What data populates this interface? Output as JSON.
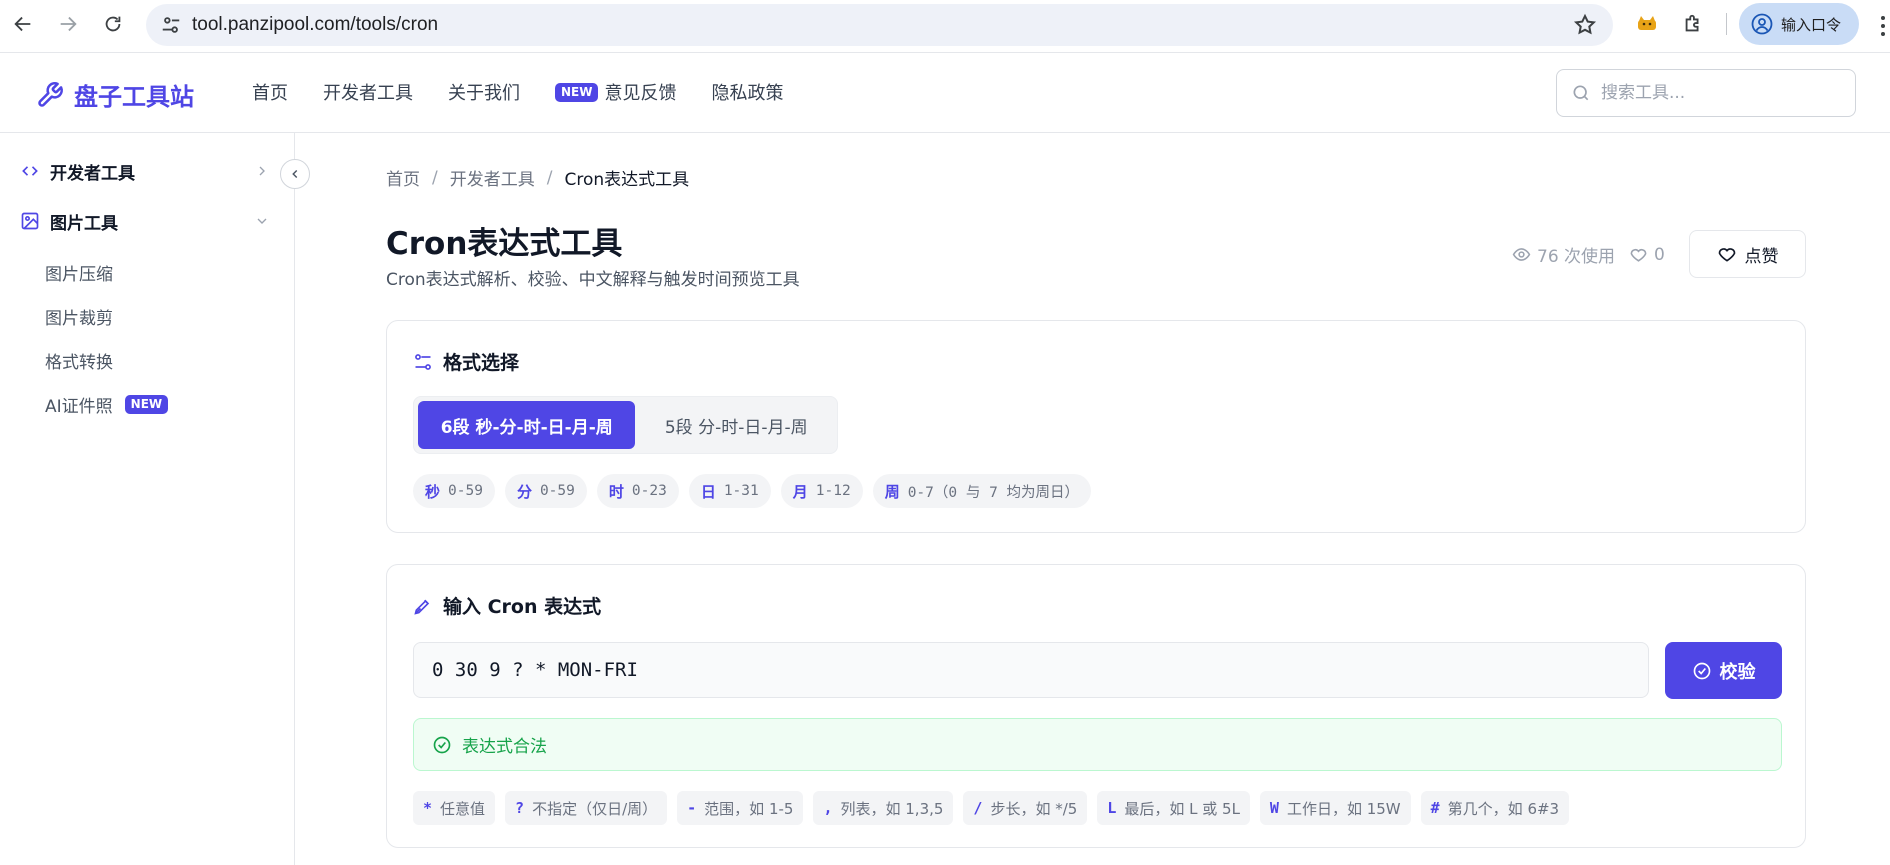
{
  "browser": {
    "url": "tool.panzipool.com/tools/cron",
    "profile_label": "输入口令"
  },
  "site": {
    "logo_text": "盘子工具站",
    "nav": [
      {
        "label": "首页"
      },
      {
        "label": "开发者工具"
      },
      {
        "label": "关于我们"
      },
      {
        "label": "意见反馈",
        "badge": "NEW"
      },
      {
        "label": "隐私政策"
      }
    ],
    "search_placeholder": "搜索工具..."
  },
  "sidebar": {
    "groups": [
      {
        "label": "开发者工具",
        "icon": "code-icon",
        "expanded": false
      },
      {
        "label": "图片工具",
        "icon": "image-icon",
        "expanded": true
      }
    ],
    "items": [
      {
        "label": "图片压缩"
      },
      {
        "label": "图片裁剪"
      },
      {
        "label": "格式转换"
      },
      {
        "label": "AI证件照",
        "badge": "NEW"
      }
    ]
  },
  "breadcrumb": {
    "items": [
      "首页",
      "开发者工具",
      "Cron表达式工具"
    ],
    "separator": "/"
  },
  "page": {
    "title": "Cron表达式工具",
    "subtitle": "Cron表达式解析、校验、中文解释与触发时间预览工具",
    "views": "76 次使用",
    "likes": "0",
    "like_label": "点赞"
  },
  "format_card": {
    "title": "格式选择",
    "options": [
      {
        "label": "6段 秒-分-时-日-月-周",
        "active": true
      },
      {
        "label": "5段 分-时-日-月-周",
        "active": false
      }
    ],
    "fields": [
      {
        "key": "秒",
        "range": "0-59"
      },
      {
        "key": "分",
        "range": "0-59"
      },
      {
        "key": "时",
        "range": "0-23"
      },
      {
        "key": "日",
        "range": "1-31"
      },
      {
        "key": "月",
        "range": "1-12"
      },
      {
        "key": "周",
        "range": "0-7（0 与 7 均为周日）"
      }
    ]
  },
  "input_card": {
    "title": "输入 Cron 表达式",
    "expression": "0 30 9 ? * MON-FRI",
    "verify_label": "校验",
    "status": "表达式合法",
    "hints": [
      {
        "key": "*",
        "text": "任意值"
      },
      {
        "key": "?",
        "text": "不指定（仅日/周）"
      },
      {
        "key": "-",
        "text": "范围，如 1-5"
      },
      {
        "key": ",",
        "text": "列表，如 1,3,5"
      },
      {
        "key": "/",
        "text": "步长，如 */5"
      },
      {
        "key": "L",
        "text": "最后，如 L 或 5L"
      },
      {
        "key": "W",
        "text": "工作日，如 15W"
      },
      {
        "key": "#",
        "text": "第几个，如 6#3"
      }
    ]
  },
  "colors": {
    "accent": "#4f46e5",
    "success": "#16a34a",
    "success_bg": "#f0fdf4"
  }
}
